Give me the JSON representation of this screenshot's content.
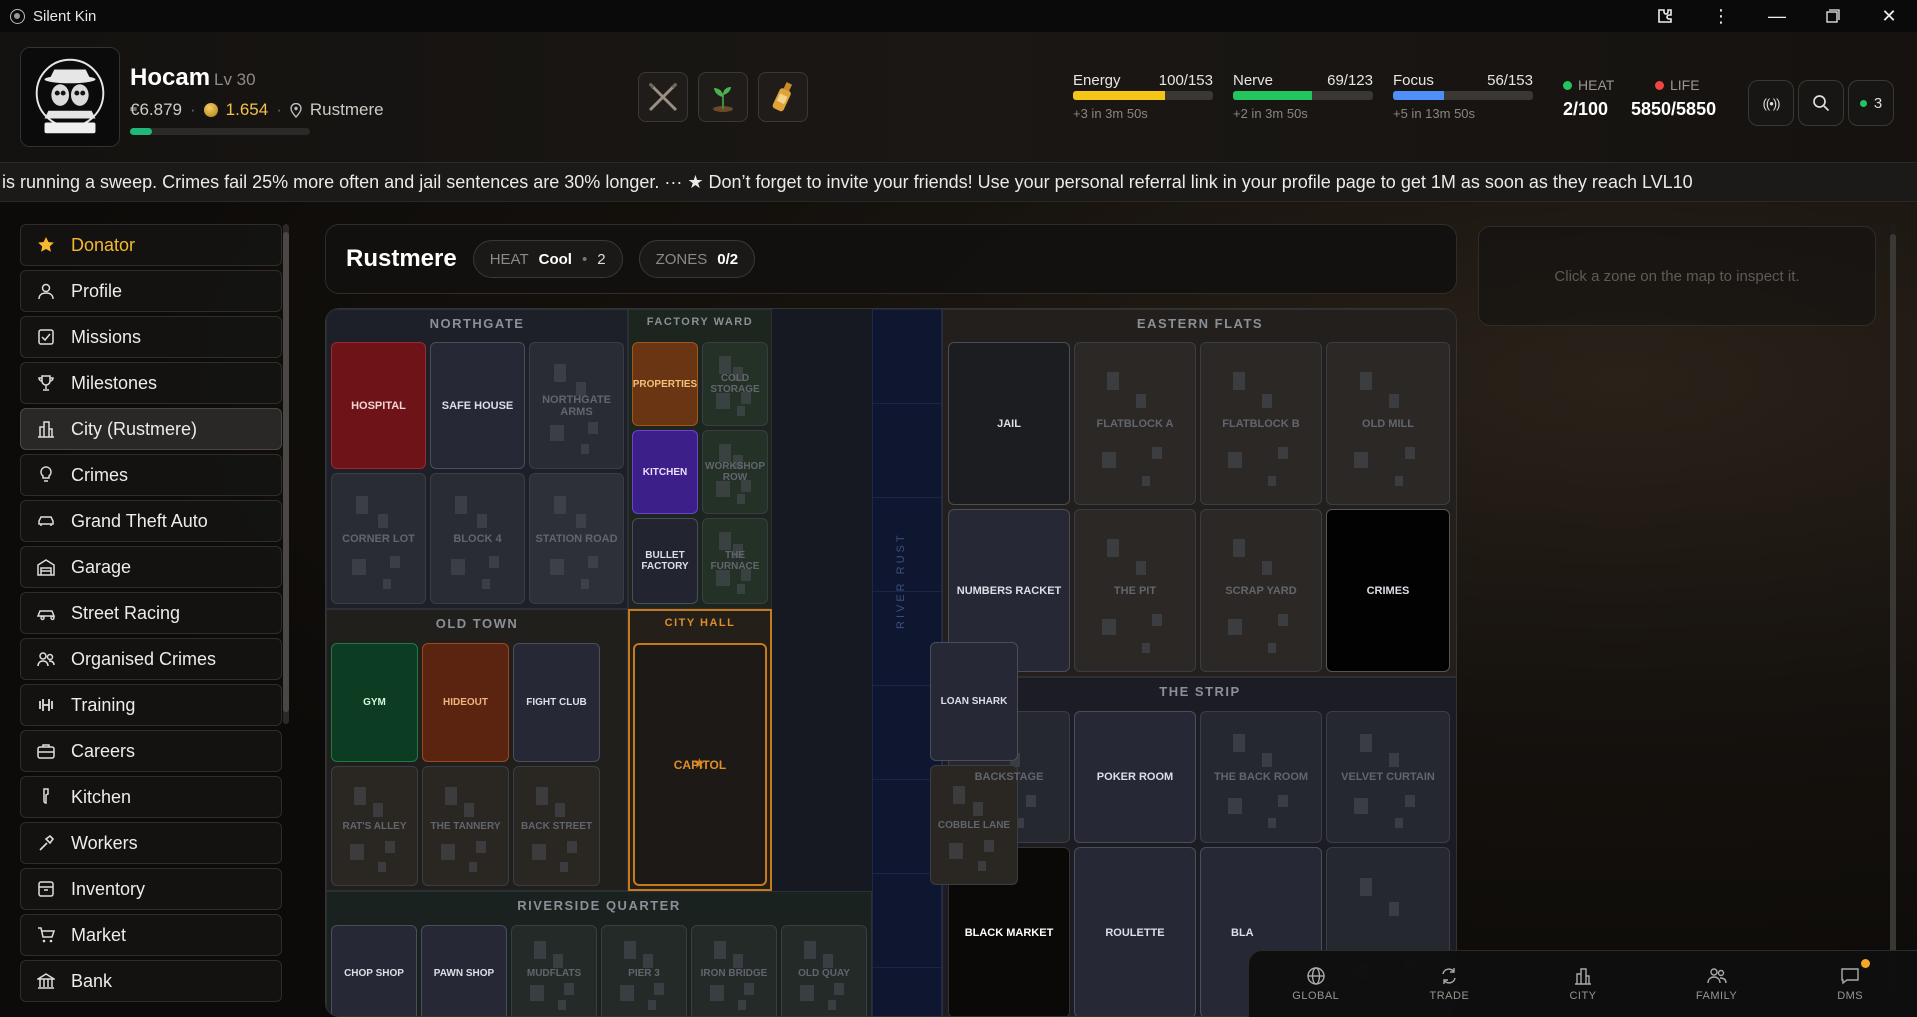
{
  "window": {
    "title": "Silent Kin"
  },
  "player": {
    "name": "Hocam",
    "level": "Lv 30",
    "cash": "€6.879",
    "coins": "1.654",
    "location": "Rustmere",
    "xp_progress": 0.12
  },
  "equipment": [
    {
      "icon": "crossed-rifles-icon"
    },
    {
      "icon": "plant-icon"
    },
    {
      "icon": "bottle-icon"
    }
  ],
  "bars": {
    "energy": {
      "label": "Energy",
      "value": "100/153",
      "regen": "+3 in 3m 50s",
      "fraction": 0.654,
      "color": "#f5c518"
    },
    "nerve": {
      "label": "Nerve",
      "value": "69/123",
      "regen": "+2 in 3m 50s",
      "fraction": 0.561,
      "color": "#22c55e"
    },
    "focus": {
      "label": "Focus",
      "value": "56/153",
      "regen": "+5 in 13m 50s",
      "fraction": 0.366,
      "color": "#4f8ff7"
    }
  },
  "heat": {
    "label": "HEAT",
    "value": "2/100",
    "color": "#22c55e"
  },
  "life": {
    "label": "LIFE",
    "value": "5850/5850",
    "color": "#ef4444"
  },
  "header_buttons": {
    "online_count": "3"
  },
  "ticker": {
    "text": "is running a sweep. Crimes fail 25% more often and jail sentences are 30% longer. ··· ★ Don’t forget to invite your friends! Use your personal referral link in your profile page to get 1M as soon as they reach LVL10"
  },
  "sidebar": {
    "items": [
      {
        "label": "Donator",
        "icon": "star-icon"
      },
      {
        "label": "Profile",
        "icon": "user-icon"
      },
      {
        "label": "Missions",
        "icon": "checklist-icon"
      },
      {
        "label": "Milestones",
        "icon": "trophy-icon"
      },
      {
        "label": "City (Rustmere)",
        "icon": "city-icon"
      },
      {
        "label": "Crimes",
        "icon": "bulb-icon"
      },
      {
        "label": "Grand Theft Auto",
        "icon": "car-icon"
      },
      {
        "label": "Garage",
        "icon": "garage-icon"
      },
      {
        "label": "Street Racing",
        "icon": "race-car-icon"
      },
      {
        "label": "Organised Crimes",
        "icon": "group-icon"
      },
      {
        "label": "Training",
        "icon": "dumbbell-icon"
      },
      {
        "label": "Careers",
        "icon": "briefcase-icon"
      },
      {
        "label": "Kitchen",
        "icon": "flask-icon"
      },
      {
        "label": "Workers",
        "icon": "hammer-icon"
      },
      {
        "label": "Inventory",
        "icon": "box-icon"
      },
      {
        "label": "Market",
        "icon": "cart-icon"
      },
      {
        "label": "Bank",
        "icon": "bank-icon"
      }
    ]
  },
  "city": {
    "title": "Rustmere",
    "heat_label": "HEAT",
    "heat_state": "Cool",
    "heat_value": "2",
    "zones_label": "ZONES",
    "zones_value": "0/2",
    "inspect_hint": "Click a zone on the map to inspect it.",
    "river": "RIVER RUST",
    "districts": {
      "northgate": "NORTHGATE",
      "factory_ward": "FACTORY WARD",
      "eastern_flats": "EASTERN FLATS",
      "old_town": "OLD TOWN",
      "city_hall": "CITY HALL",
      "the_strip": "THE STRIP",
      "riverside": "RIVERSIDE QUARTER"
    },
    "zones": {
      "hospital": "HOSPITAL",
      "safe_house": "SAFE HOUSE",
      "northgate_arms": "NORTHGATE ARMS",
      "corner_lot": "CORNER LOT",
      "block_4": "BLOCK 4",
      "station_road": "STATION ROAD",
      "properties": "PROPERTIES",
      "cold_storage": "COLD STORAGE",
      "kitchen": "KITCHEN",
      "workshop_row": "WORKSHOP ROW",
      "bullet_factory": "BULLET FACTORY",
      "the_furnace": "THE FURNACE",
      "jail": "JAIL",
      "flatblock_a": "FLATBLOCK A",
      "flatblock_b": "FLATBLOCK B",
      "old_mill": "OLD MILL",
      "numbers_racket": "NUMBERS RACKET",
      "the_pit": "THE PIT",
      "scrap_yard": "SCRAP YARD",
      "crimes": "CRIMES",
      "gym": "GYM",
      "hideout": "HIDEOUT",
      "fight_club": "FIGHT CLUB",
      "loan_shark": "LOAN SHARK",
      "rats_alley": "RAT'S ALLEY",
      "the_tannery": "THE TANNERY",
      "back_street": "BACK STREET",
      "cobble_lane": "COBBLE LANE",
      "capitol": "CAPITOL",
      "backstage": "BACKSTAGE",
      "poker_room": "POKER ROOM",
      "the_back_room": "THE BACK ROOM",
      "velvet_curtain": "VELVET CURTAIN",
      "black_market": "BLACK MARKET",
      "roulette": "ROULETTE",
      "bla": "BLA",
      "chop_shop": "CHOP SHOP",
      "pawn_shop": "PAWN SHOP",
      "mudflats": "MUDFLATS",
      "pier_3": "PIER 3",
      "iron_bridge": "IRON BRIDGE",
      "old_quay": "OLD QUAY"
    }
  },
  "bottom_nav": [
    {
      "label": "GLOBAL",
      "icon": "globe-icon"
    },
    {
      "label": "TRADE",
      "icon": "swap-icon"
    },
    {
      "label": "CITY",
      "icon": "city-icon"
    },
    {
      "label": "FAMILY",
      "icon": "family-icon"
    },
    {
      "label": "DMS",
      "icon": "chat-icon"
    }
  ],
  "colors": {
    "accent_gold": "#f5b82e",
    "city_hall_border": "#d4841f"
  }
}
